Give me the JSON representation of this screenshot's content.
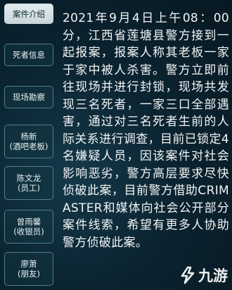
{
  "sidebar": {
    "tabs": [
      {
        "line1": "案件介绍",
        "line2": ""
      },
      {
        "line1": "死者信息",
        "line2": ""
      },
      {
        "line1": "现场勘察",
        "line2": ""
      },
      {
        "line1": "杨新",
        "line2": "(酒吧老板)"
      },
      {
        "line1": "陈文龙",
        "line2": "(员工)"
      },
      {
        "line1": "曾雨馨",
        "line2": "(收银员)"
      },
      {
        "line1": "廖萧",
        "line2": "(朋友)"
      }
    ]
  },
  "case": {
    "description": "2021年9月4日上午08：00分，江西省莲塘县警方接到一起报案，报案人称其老板一家于家中被人杀害。警方立即前往现场并进行封锁，现场共发现三名死者，一家三口全部遇害，通过对三名死者生前的人际关系进行调查，目前已锁定4名嫌疑人员，因该案件对社会影响恶劣，警方高层要求尽快侦破此案，目前警方借助CRIMASTER和媒体向社会公开部分案件线索，希望有更多人协助警方侦破此案。"
  },
  "watermark": {
    "text": "九游",
    "icon": "jiuyou-logo-icon"
  },
  "colors": {
    "background": "#0b2230",
    "tab_border": "#4f7f8b",
    "tab_active_bg": "#dfe8eb",
    "text": "#f1f4f5"
  }
}
